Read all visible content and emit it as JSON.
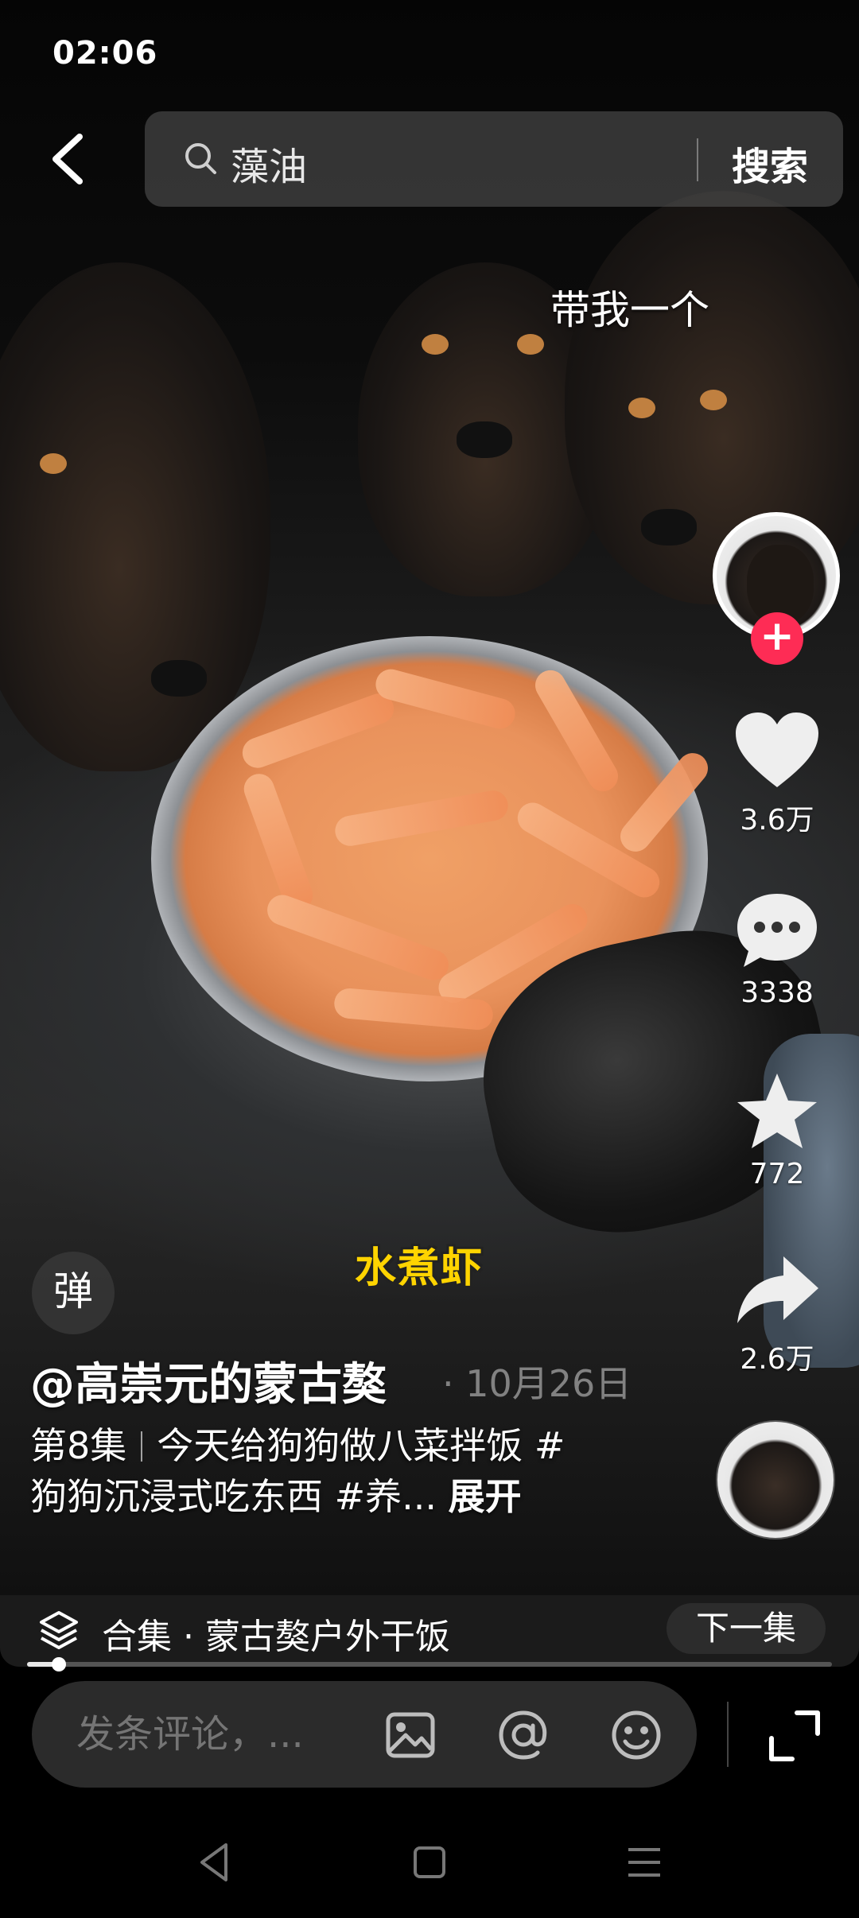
{
  "status_bar": {
    "time": "02:06"
  },
  "search": {
    "query": "藻油",
    "button_label": "搜索"
  },
  "video": {
    "overlay_caption": "带我一个",
    "subtitle": "水煮虾",
    "danmu_label": "弹"
  },
  "actions": {
    "like_count": "3.6万",
    "comment_count": "3338",
    "favorite_count": "772",
    "share_count": "2.6万",
    "follow_symbol": "+"
  },
  "post": {
    "author": "@高崇元的蒙古獒",
    "date": "· 10月26日",
    "episode": "第8集",
    "description_line1": "今天给狗狗做八菜拌饭 #",
    "description_line2": "狗狗沉浸式吃东西 #养...",
    "expand_label": "展开"
  },
  "collection": {
    "label": "合集 · 蒙古獒户外干饭",
    "next_label": "下一集"
  },
  "playback": {
    "progress_fraction": 0.04
  },
  "comment_bar": {
    "placeholder": "发条评论，..."
  },
  "colors": {
    "accent": "#fe2c55",
    "subtitle_yellow": "#ffd400"
  }
}
